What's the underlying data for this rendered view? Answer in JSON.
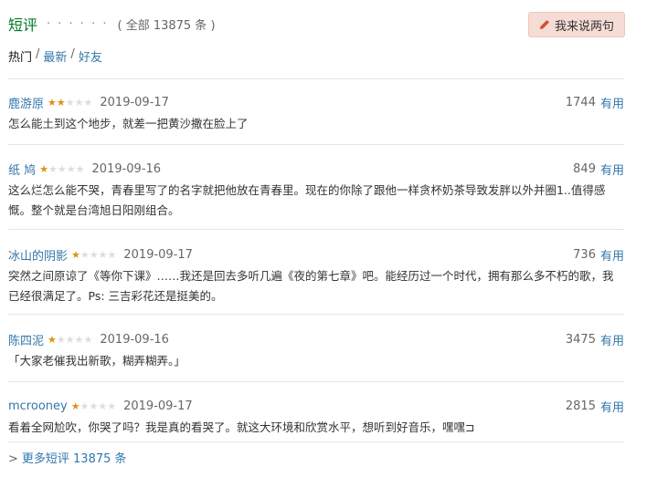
{
  "header": {
    "title": "短评",
    "dots": "· · · · · ·",
    "total": "( 全部 13875 条 )",
    "write_label": "我来说两句"
  },
  "filters": [
    {
      "label": "热门",
      "active": true
    },
    {
      "label": "最新",
      "active": false
    },
    {
      "label": "好友",
      "active": false
    }
  ],
  "filter_sep": "/",
  "useful_label": "有用",
  "comments": [
    {
      "user": "鹿游原",
      "rating": 2,
      "date": "2019-09-17",
      "votes": "1744",
      "text": "怎么能土到这个地步，就差一把黄沙撒在脸上了"
    },
    {
      "user": "纸 鸠",
      "rating": 1,
      "date": "2019-09-16",
      "votes": "849",
      "text": "这么烂怎么能不哭，青春里写了的名字就把他放在青春里。现在的你除了跟他一样贪杯奶茶导致发胖以外并圈1..值得感慨。整个就是台湾旭日阳刚组合。"
    },
    {
      "user": "冰山的阴影",
      "rating": 1,
      "date": "2019-09-17",
      "votes": "736",
      "text": "突然之间原谅了《等你下课》……我还是回去多听几遍《夜的第七章》吧。能经历过一个时代，拥有那么多不朽的歌，我已经很满足了。Ps: 三吉彩花还是挺美的。"
    },
    {
      "user": "陈四泥",
      "rating": 1,
      "date": "2019-09-16",
      "votes": "3475",
      "text": "「大家老催我出新歌，糊弄糊弄。」"
    },
    {
      "user": "mcrooney",
      "rating": 1,
      "date": "2019-09-17",
      "votes": "2815",
      "text": "看着全网尬吹，你哭了吗？我是真的看哭了。就这大环境和欣赏水平，想听到好音乐，嘿嘿⊐"
    }
  ],
  "more": {
    "arrow": ">",
    "label": "更多短评 13875 条"
  },
  "colors": {
    "title": "#007722",
    "link": "#3377aa",
    "star": "#e09015",
    "button_bg": "#f5dcd5"
  },
  "icons": {
    "write": "pencil-icon",
    "star": "star-icon"
  }
}
